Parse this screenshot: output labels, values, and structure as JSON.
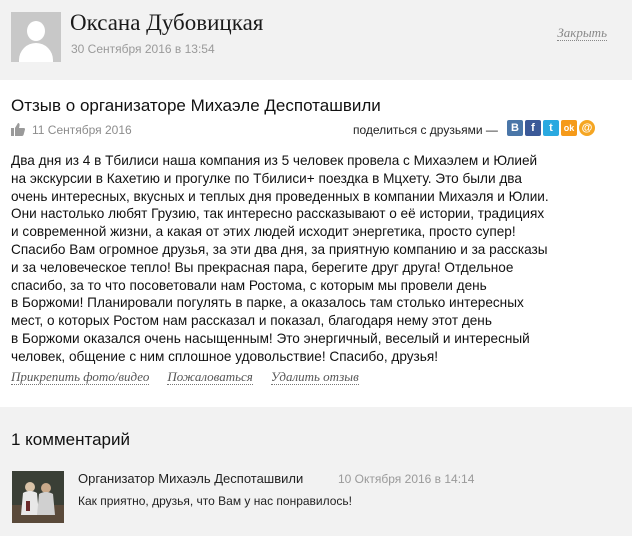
{
  "user": {
    "name": "Оксана Дубовицкая",
    "date": "30 Сентября 2016 в 13:54",
    "close_label": "Закрыть"
  },
  "review": {
    "title": "Отзыв о организаторе Михаэле Деспоташвили",
    "date": "11 Сентября 2016",
    "share_label": "поделиться с друзьями —",
    "share_icons": [
      {
        "name": "vk-icon",
        "glyph": "В",
        "color": "#4a76a8"
      },
      {
        "name": "facebook-icon",
        "glyph": "f",
        "color": "#3b5998"
      },
      {
        "name": "twitter-icon",
        "glyph": "t",
        "color": "#2aa9e0"
      },
      {
        "name": "odnoklassniki-icon",
        "glyph": "ok",
        "color": "#f59a1a"
      },
      {
        "name": "mail-ru-icon",
        "glyph": "@",
        "color": "#f5a623"
      }
    ],
    "lines": [
      "Два дня из 4 в Тбилиси наша компания из 5 человек провела с Михаэлем и Юлией",
      "на экскурсии в Кахетию и прогулке по Тбилиси+ поездка в Мцхету. Это были два",
      "очень интересных, вкусных и теплых дня проведенных в компании Михаэля и Юлии.",
      "Они настолько любят Грузию, так интересно рассказывают о её истории, традициях",
      "и современной жизни, а какая от этих людей исходит энергетика, просто супер!",
      "Спасибо Вам огромное друзья, за эти два дня, за приятную компанию и за рассказы",
      "и за человеческое тепло! Вы прекрасная пара, берегите друг друга! Отдельное",
      "спасибо, за то что посоветовали нам Ростома, с которым мы провели день",
      "в Боржоми! Планировали погулять в парке, а оказалось там столько интересных",
      "мест, о которых Ростом нам рассказал и показал, благодаря нему этот день",
      "в Боржоми оказался очень насыщенным! Это энергичный, веселый и интересный",
      "человек, общение с ним сплошное удовольствие! Спасибо, друзья!"
    ],
    "actions": {
      "attach_photo": "Прикрепить фото/видео",
      "complain": "Пожаловаться",
      "delete": "Удалить отзыв"
    }
  },
  "comments": {
    "title": "1 комментарий",
    "items": [
      {
        "author": "Организатор Михаэль Деспоташвили",
        "date": "10 Октября 2016 в 14:14",
        "text": "Как приятно, друзья, что Вам у нас понравилось!"
      }
    ]
  }
}
